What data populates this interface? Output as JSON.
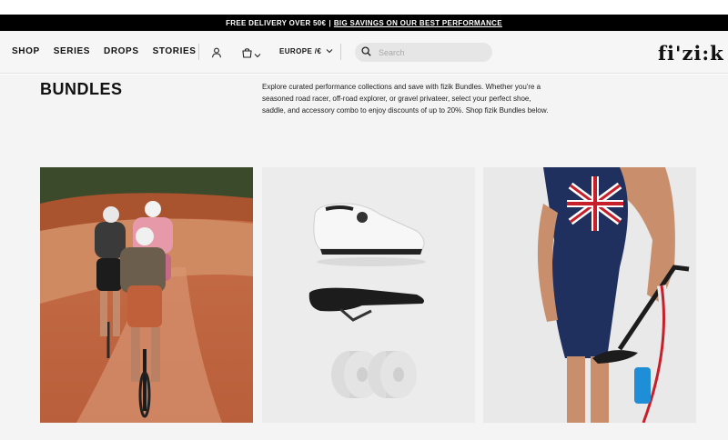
{
  "promo": {
    "text": "FREE DELIVERY OVER 50€",
    "separator": "|",
    "link": "BIG SAVINGS ON OUR BEST PERFORMANCE"
  },
  "nav": {
    "items": [
      "SHOP",
      "SERIES",
      "DROPS",
      "STORIES"
    ]
  },
  "header": {
    "region": "EUROPE /€",
    "search_placeholder": "Search",
    "logo": "fi'zi:k"
  },
  "page": {
    "title": "BUNDLES",
    "intro": "Explore curated performance collections and save with fizik Bundles. Whether you're a seasoned road racer, off-road explorer, or gravel privateer, select your perfect shoe, saddle, and accessory combo to enjoy discounts of up to 20%. Shop fizik Bundles below."
  },
  "colors": {
    "promo_bg": "#000000",
    "header_bg": "#f6f6f6",
    "page_bg": "#f4f4f4",
    "search_bg": "#e6e6e6"
  },
  "icons": [
    "user-icon",
    "bag-icon",
    "chevron-down-icon",
    "search-icon"
  ]
}
